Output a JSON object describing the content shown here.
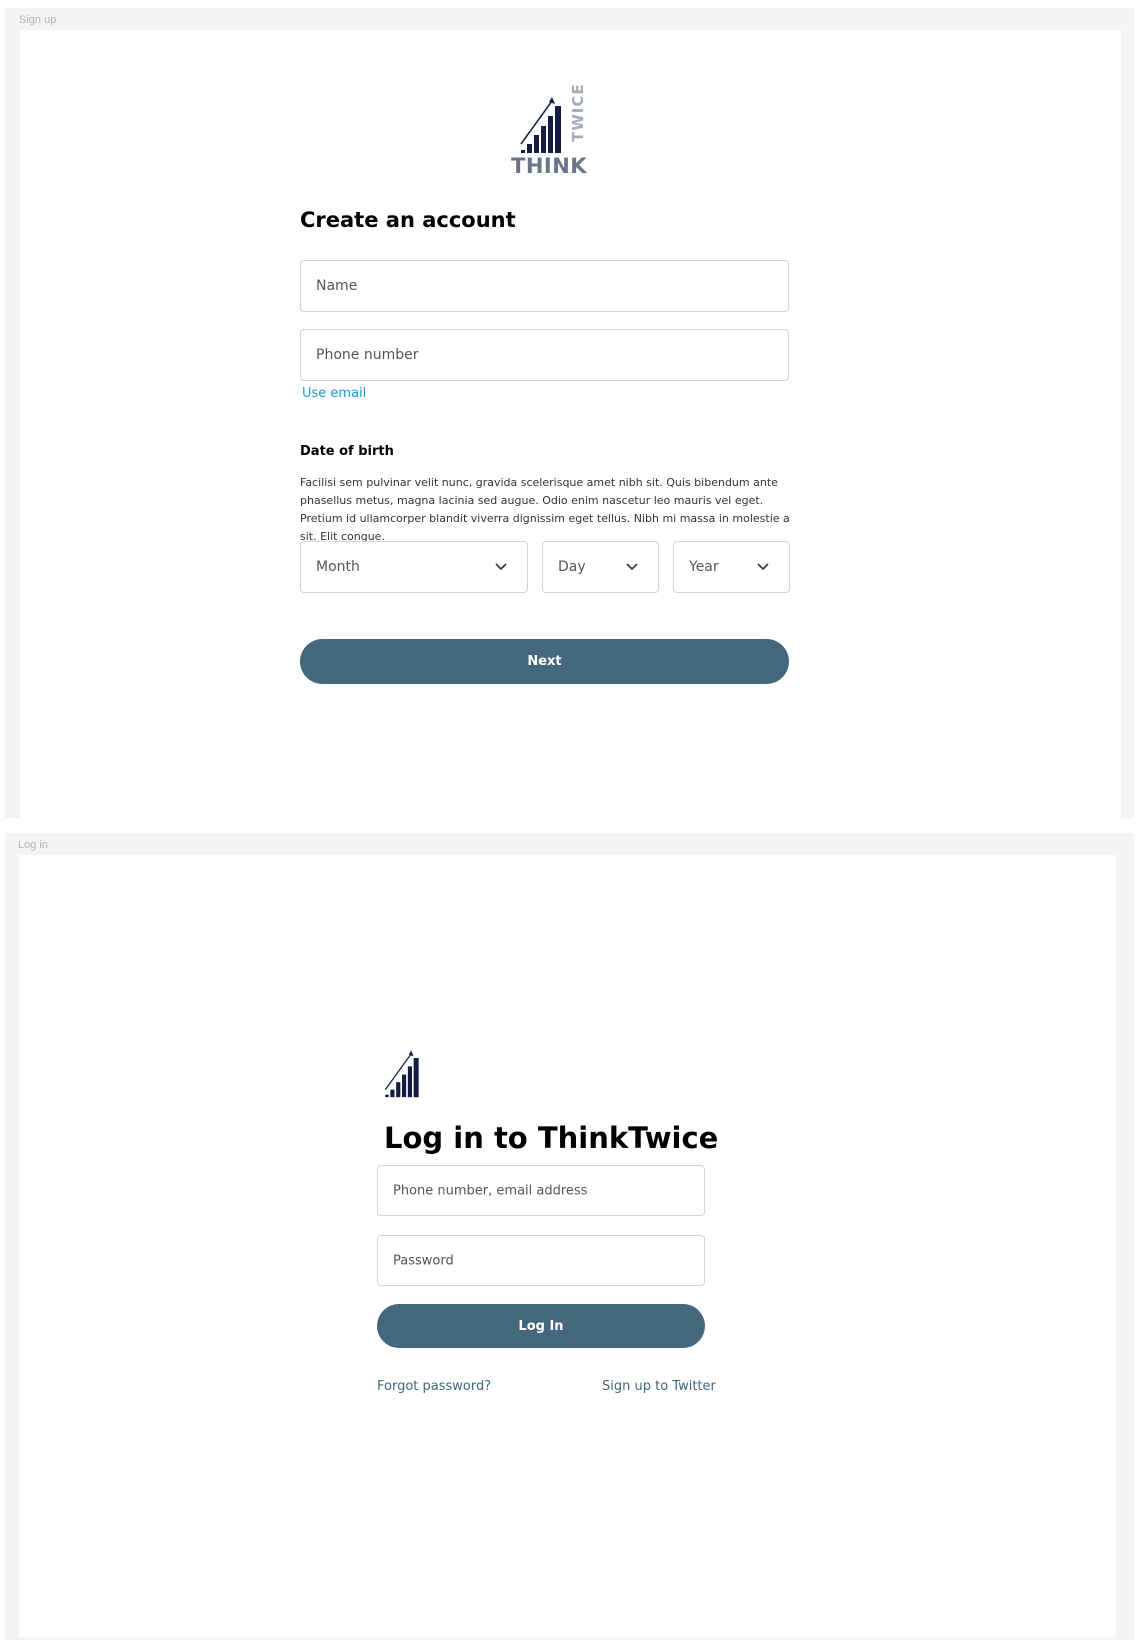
{
  "signup": {
    "frame_label": "Sign up",
    "logo": {
      "word1": "THINK",
      "word2": "TWICE"
    },
    "title": "Create an account",
    "name_placeholder": "Name",
    "phone_placeholder": "Phone number",
    "use_email_link": "Use email",
    "dob_heading": "Date of birth",
    "dob_text": "Facilisi sem pulvinar velit nunc, gravida scelerisque amet nibh sit. Quis bibendum ante phasellus metus, magna lacinia sed augue. Odio enim nascetur leo mauris vel eget. Pretium id ullamcorper blandit viverra dignissim eget tellus. Nibh mi massa in molestie a sit. Elit congue.",
    "month_label": "Month",
    "day_label": "Day",
    "year_label": "Year",
    "next_button": "Next"
  },
  "login": {
    "frame_label": "Log in",
    "title": "Log in to ThinkTwice",
    "identifier_placeholder": "Phone number, email address",
    "password_placeholder": "Password",
    "login_button": "Log In",
    "forgot_link": "Forgot password?",
    "signup_link": "Sign up to Twitter"
  },
  "colors": {
    "primary_button": "#43677d",
    "email_link": "#1a9ad6",
    "secondary_link": "#43677d",
    "logo_navy": "#141c45",
    "logo_gray": "#6b7588"
  },
  "icons": [
    "think-twice-bar-chart-logo",
    "chevron-down-icon"
  ]
}
